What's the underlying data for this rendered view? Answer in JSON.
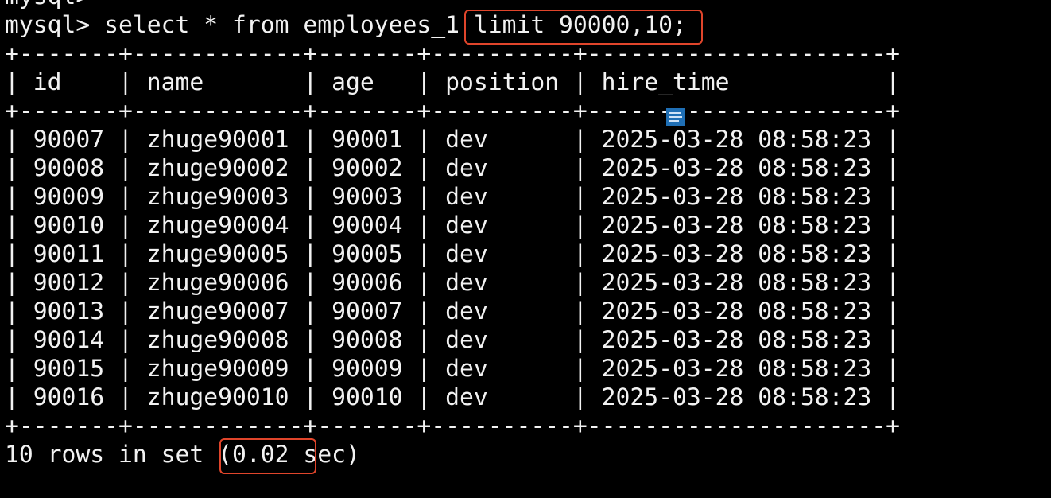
{
  "terminal": {
    "prev_prompt": "mysql>",
    "command_line": "mysql> select * from employees_1 limit 90000,10;",
    "border_line": "+-------+------------+-------+----------+---------------------+",
    "header_line": "| id    | name       | age   | position | hire_time           |",
    "rows": [
      "| 90007 | zhuge90001 | 90001 | dev      | 2025-03-28 08:58:23 |",
      "| 90008 | zhuge90002 | 90002 | dev      | 2025-03-28 08:58:23 |",
      "| 90009 | zhuge90003 | 90003 | dev      | 2025-03-28 08:58:23 |",
      "| 90010 | zhuge90004 | 90004 | dev      | 2025-03-28 08:58:23 |",
      "| 90011 | zhuge90005 | 90005 | dev      | 2025-03-28 08:58:23 |",
      "| 90012 | zhuge90006 | 90006 | dev      | 2025-03-28 08:58:23 |",
      "| 90013 | zhuge90007 | 90007 | dev      | 2025-03-28 08:58:23 |",
      "| 90014 | zhuge90008 | 90008 | dev      | 2025-03-28 08:58:23 |",
      "| 90015 | zhuge90009 | 90009 | dev      | 2025-03-28 08:58:23 |",
      "| 90016 | zhuge90010 | 90010 | dev      | 2025-03-28 08:58:23 |"
    ],
    "result_line": "10 rows in set (0.02 sec)"
  },
  "colors": {
    "background": "#000000",
    "text": "#f2f2f2",
    "highlight_border": "#e0452b",
    "cursor_icon": "#1f6fb5"
  },
  "icons": {
    "cursor": "text-cursor-icon"
  }
}
